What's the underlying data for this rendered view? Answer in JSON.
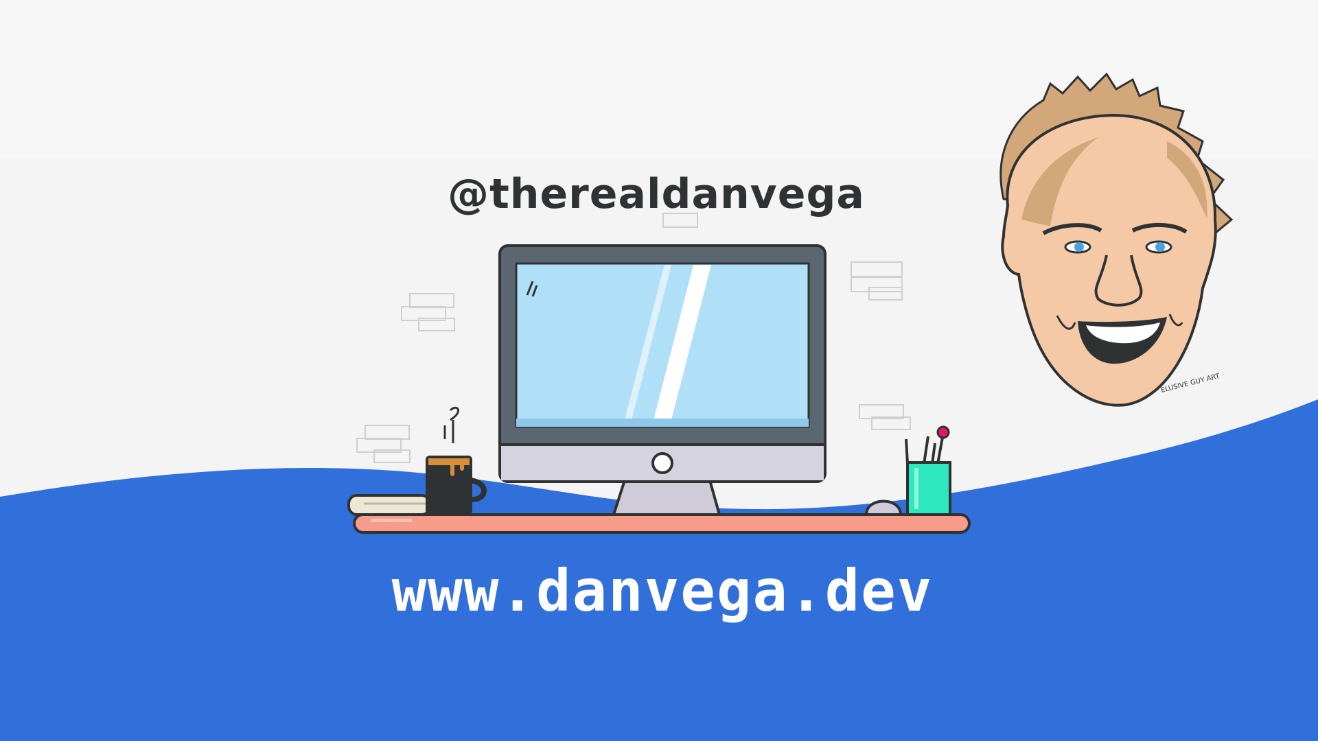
{
  "banner": {
    "handle": "@therealdanvega",
    "website": "www.danvega.dev",
    "caricature_signature": "ELUSIVE GUY ART"
  },
  "colors": {
    "background": "#f4f4f4",
    "wave": "#3170da",
    "screen": "#b0e0f8",
    "monitor_frame": "#5a6670",
    "desk": "#f79c8b",
    "pen_cup": "#2de8bf",
    "mug": "#2f3233",
    "skin": "#f6c9a6",
    "hair": "#d2a77a"
  },
  "icons": [
    "monitor-illustration",
    "coffee-mug-icon",
    "pen-cup-icon",
    "mouse-icon",
    "book-icon",
    "caricature-portrait"
  ]
}
